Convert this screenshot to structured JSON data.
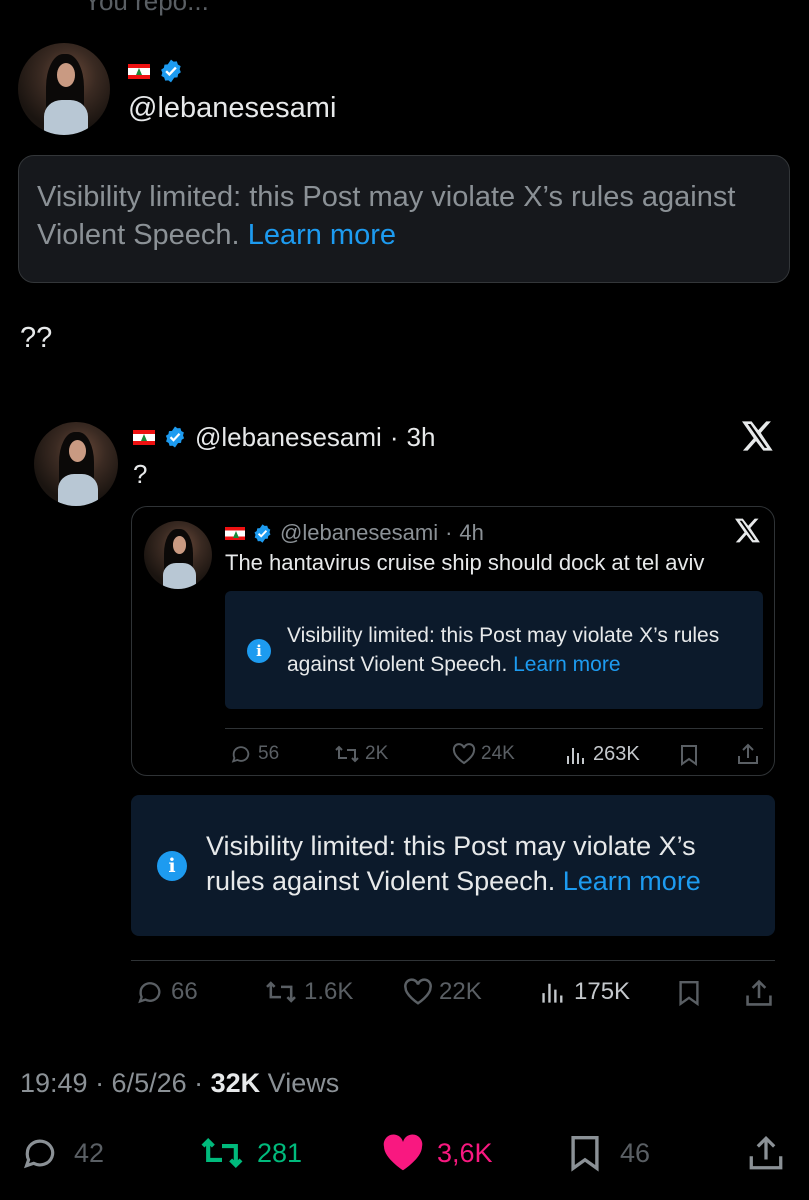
{
  "top_cut_text": "You repo...",
  "post": {
    "handle": "@lebanesesami",
    "notice_text": "Visibility limited: this Post may violate X’s rules against Violent Speech.",
    "notice_link": "Learn more",
    "body": "??",
    "timestamp": "19:49 · 6/5/26 · ",
    "views_count": "32K",
    "views_label": "Views",
    "actions": {
      "replies": "42",
      "reposts": "281",
      "likes": "3,6K",
      "bookmarks": "46"
    }
  },
  "quoted": {
    "handle": "@lebanesesami",
    "time": "3h",
    "body": "?",
    "notice_text": "Visibility limited: this Post may violate X’s rules against Violent Speech.",
    "notice_link": "Learn more",
    "actions": {
      "replies": "66",
      "reposts": "1.6K",
      "likes": "22K",
      "views": "175K"
    }
  },
  "nested": {
    "handle": "@lebanesesami",
    "time": "4h",
    "body": "The hantavirus cruise ship should dock at tel aviv",
    "notice_text": "Visibility limited: this Post may violate X’s rules against Violent Speech.",
    "notice_link": "Learn more",
    "actions": {
      "replies": "56",
      "reposts": "2K",
      "likes": "24K",
      "views": "263K"
    }
  },
  "colors": {
    "background": "#000000",
    "accent": "#1d9bf0",
    "repost_green": "#00ba7c",
    "like_pink": "#f91880",
    "muted": "#71767b"
  },
  "icons": [
    "flag-lebanon-icon",
    "verified-badge-icon",
    "x-logo-icon",
    "info-icon",
    "reply-icon",
    "repost-icon",
    "like-icon",
    "views-icon",
    "bookmark-icon",
    "share-icon"
  ]
}
